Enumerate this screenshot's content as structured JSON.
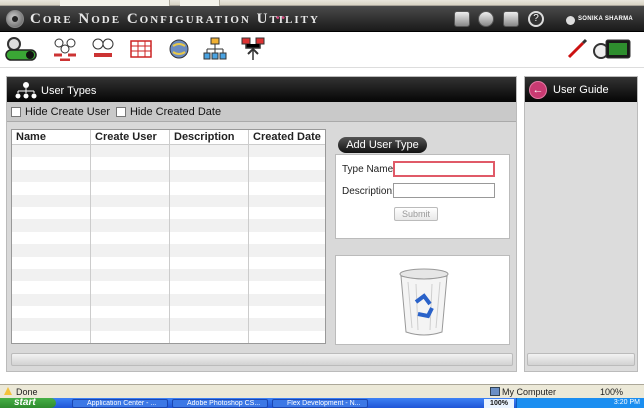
{
  "app": {
    "title": "Core Node Configuration Utility",
    "title_decoration": "••",
    "user_name": "SONIKA SHARMA"
  },
  "header_icons": [
    "notes-icon",
    "chart-icon",
    "mail-icon",
    "help-icon"
  ],
  "toolbar": {
    "items": [
      "user-toggle-icon",
      "users-group-icon",
      "user-roles-icon",
      "table-icon",
      "globe-icon",
      "hierarchy-icon",
      "network-upload-icon"
    ],
    "right_items": [
      "pencil-icon",
      "screen-config-icon"
    ]
  },
  "left_panel": {
    "title": "User Types",
    "filters": [
      {
        "label": "Hide Create User",
        "checked": false
      },
      {
        "label": "Hide Created Date",
        "checked": false
      }
    ],
    "columns": [
      "Name",
      "Create User",
      "Description",
      "Created Date"
    ],
    "rows": []
  },
  "form": {
    "add_button": "Add User Type",
    "type_name_label": "Type Name:",
    "type_name_value": "",
    "description_label": "Description:",
    "description_value": "",
    "submit_label": "Submit"
  },
  "right_panel": {
    "title": "User Guide"
  },
  "status_bar": {
    "status": "Done",
    "zone": "My Computer",
    "zoom": "100%"
  },
  "taskbar": {
    "start": "start",
    "tasks": [
      "Application Center - ...",
      "Adobe Photoshop CS...",
      "Flex Development - N..."
    ],
    "tray_percent": "100%",
    "clock": "3:20 PM"
  },
  "colors": {
    "accent_pink": "#c93a72",
    "header_dark": "#1a1a1a",
    "invalid_field_border": "#e05a68"
  }
}
